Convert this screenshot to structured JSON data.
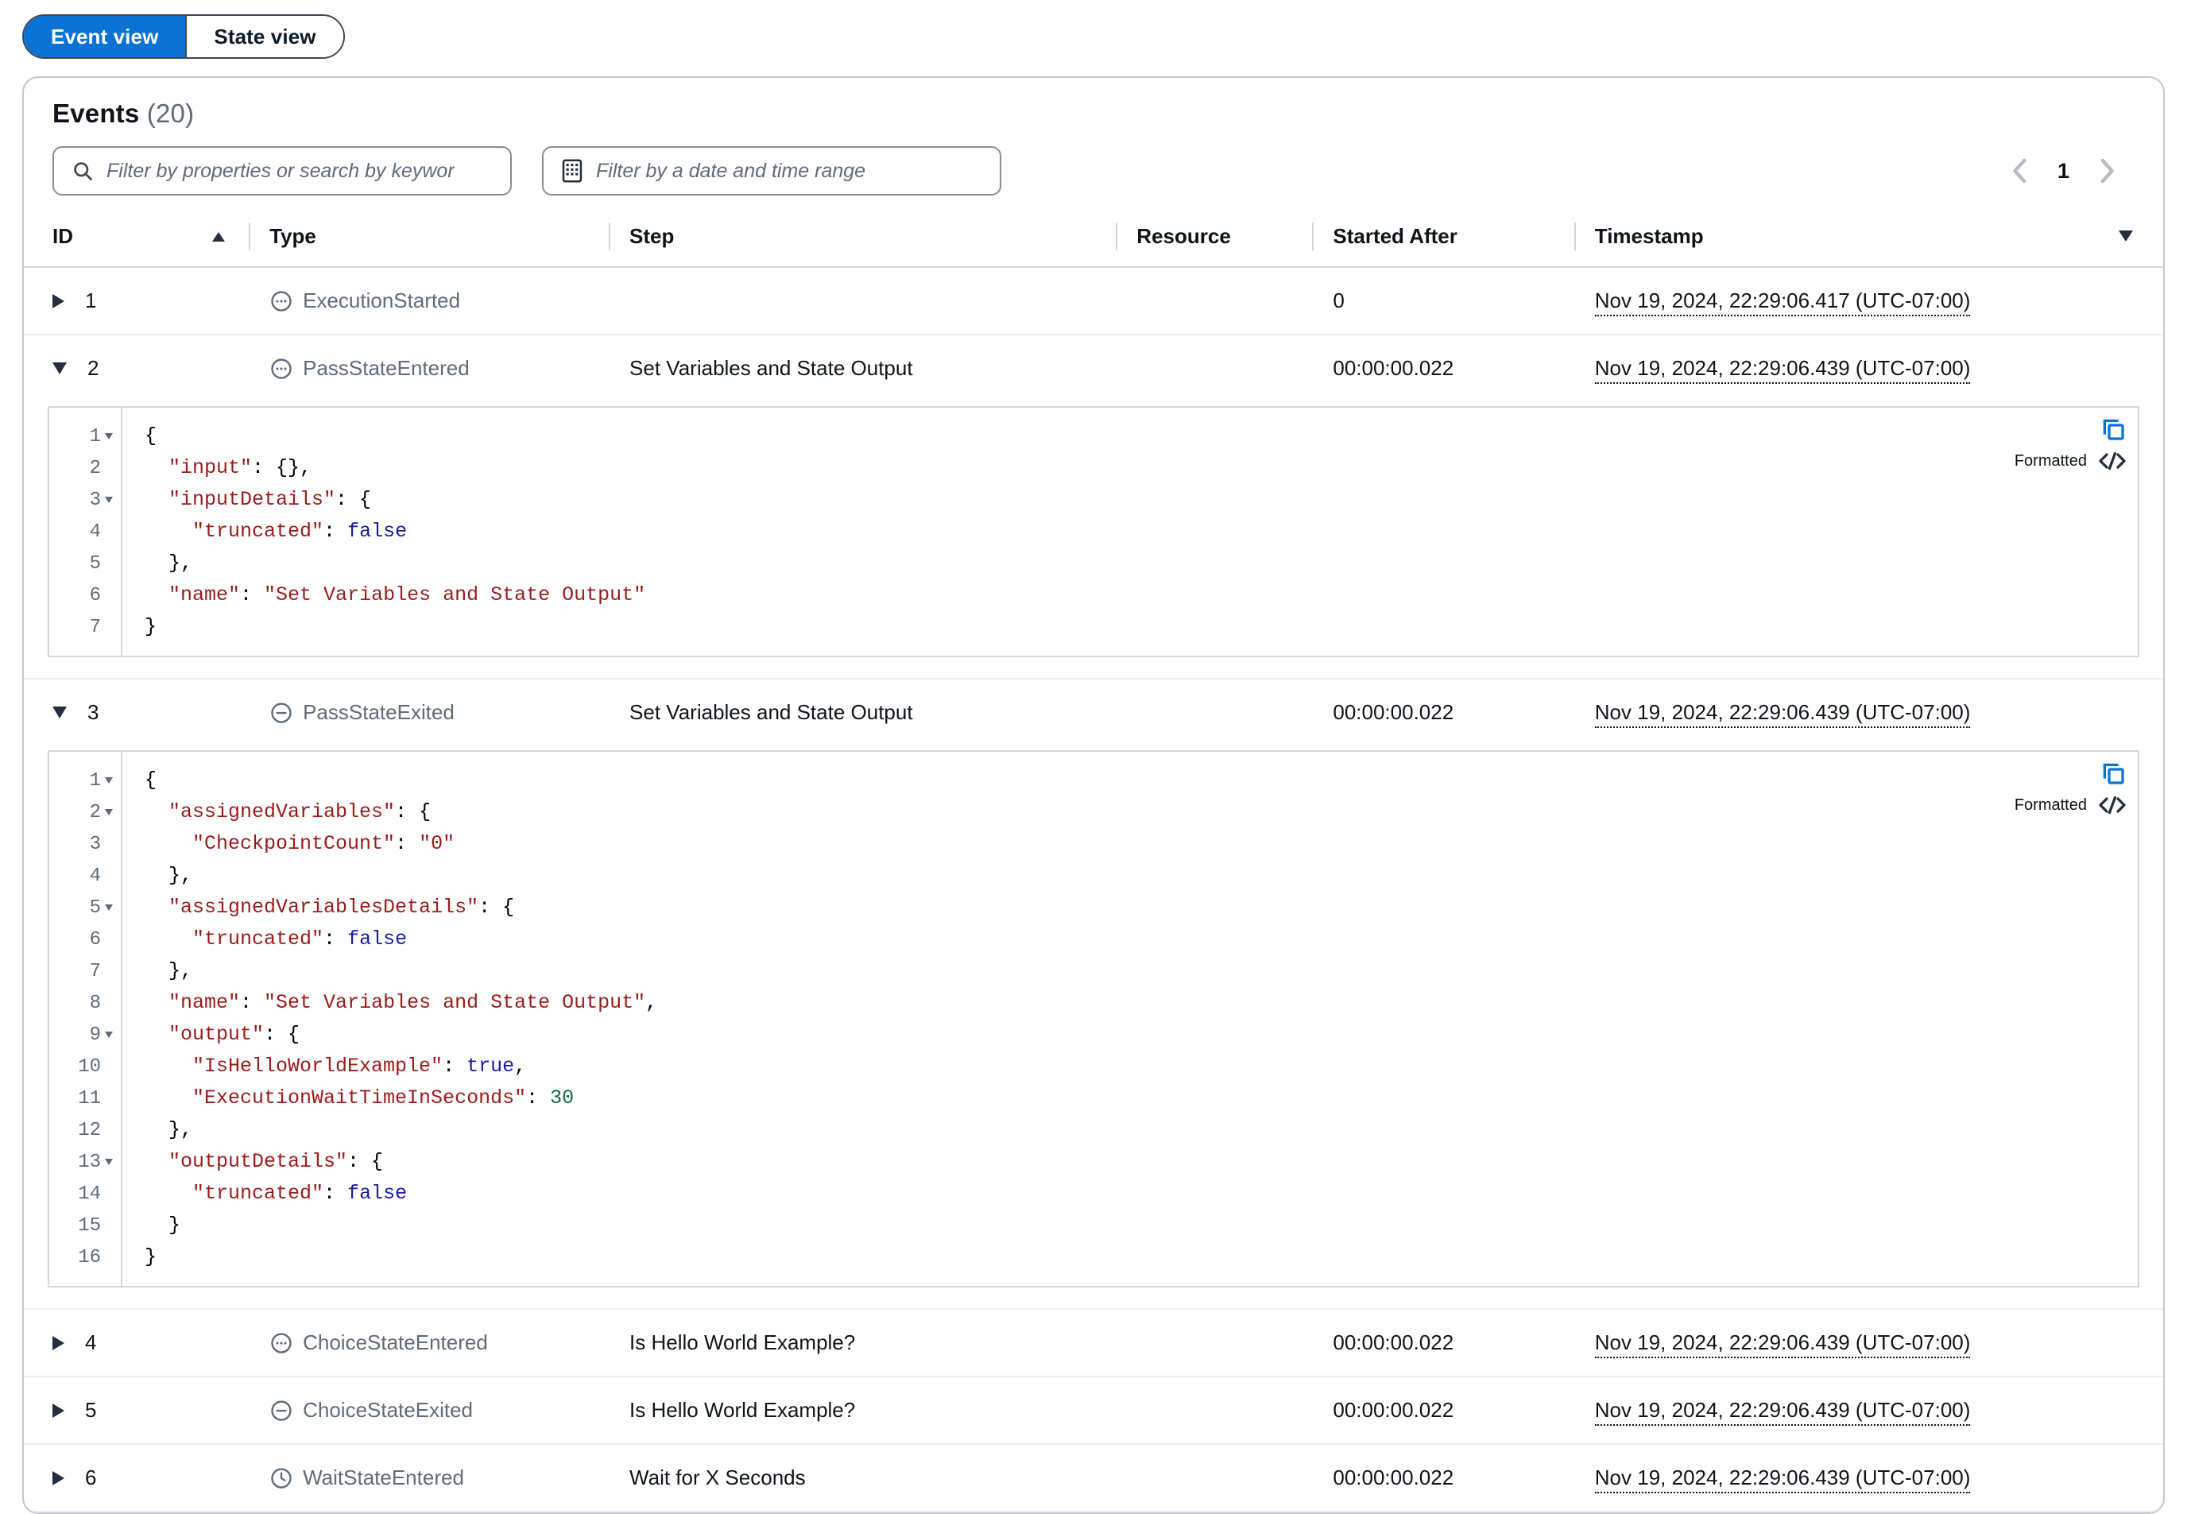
{
  "view_toggle": {
    "options": [
      {
        "label": "Event view",
        "selected": true
      },
      {
        "label": "State view",
        "selected": false
      }
    ],
    "accent_color": "#0972d3"
  },
  "panel": {
    "title": "Events",
    "count": "(20)",
    "search": {
      "placeholder": "Filter by properties or search by keywor",
      "icon": "search-icon",
      "value": ""
    },
    "date_filter": {
      "placeholder": "Filter by a date and time range",
      "icon": "calendar-icon",
      "value": ""
    },
    "pagination": {
      "prev_icon": "chevron-left-icon",
      "next_icon": "chevron-right-icon",
      "current_page": "1"
    }
  },
  "table": {
    "columns": [
      {
        "key": "id",
        "label": "ID",
        "sort_icon": "sort-ascending-icon"
      },
      {
        "key": "type",
        "label": "Type"
      },
      {
        "key": "step",
        "label": "Step"
      },
      {
        "key": "resource",
        "label": "Resource"
      },
      {
        "key": "started_after",
        "label": "Started After"
      },
      {
        "key": "timestamp",
        "label": "Timestamp",
        "settings_icon": "filter-icon"
      }
    ],
    "rows": [
      {
        "id": "1",
        "expanded": false,
        "caret": "caret-right-icon",
        "type": "ExecutionStarted",
        "type_icon": "circle-ellipsis-icon",
        "step": "",
        "resource": "",
        "started_after": "0",
        "timestamp": "Nov 19, 2024, 22:29:06.417 (UTC-07:00)"
      },
      {
        "id": "2",
        "expanded": true,
        "caret": "caret-down-icon",
        "type": "PassStateEntered",
        "type_icon": "circle-ellipsis-icon",
        "step": "Set Variables and State Output",
        "resource": "",
        "started_after": "00:00:00.022",
        "timestamp": "Nov 19, 2024, 22:29:06.439 (UTC-07:00)",
        "detail": {
          "formatted_label": "Formatted",
          "copy_icon": "copy-icon",
          "code_icon": "code-brackets-icon",
          "lines": [
            {
              "n": "1",
              "fold": true,
              "tokens": [
                {
                  "t": "{",
                  "c": "p"
                }
              ]
            },
            {
              "n": "2",
              "fold": false,
              "tokens": [
                {
                  "t": "  \"input\"",
                  "c": "k"
                },
                {
                  "t": ": ",
                  "c": "p"
                },
                {
                  "t": "{},",
                  "c": "p"
                }
              ]
            },
            {
              "n": "3",
              "fold": true,
              "tokens": [
                {
                  "t": "  \"inputDetails\"",
                  "c": "k"
                },
                {
                  "t": ": {",
                  "c": "p"
                }
              ]
            },
            {
              "n": "4",
              "fold": false,
              "tokens": [
                {
                  "t": "    \"truncated\"",
                  "c": "k"
                },
                {
                  "t": ": ",
                  "c": "p"
                },
                {
                  "t": "false",
                  "c": "b"
                }
              ]
            },
            {
              "n": "5",
              "fold": false,
              "tokens": [
                {
                  "t": "  },",
                  "c": "p"
                }
              ]
            },
            {
              "n": "6",
              "fold": false,
              "tokens": [
                {
                  "t": "  \"name\"",
                  "c": "k"
                },
                {
                  "t": ": ",
                  "c": "p"
                },
                {
                  "t": "\"Set Variables and State Output\"",
                  "c": "s"
                }
              ]
            },
            {
              "n": "7",
              "fold": false,
              "tokens": [
                {
                  "t": "}",
                  "c": "p"
                }
              ]
            }
          ]
        }
      },
      {
        "id": "3",
        "expanded": true,
        "caret": "caret-down-icon",
        "type": "PassStateExited",
        "type_icon": "circle-minus-icon",
        "step": "Set Variables and State Output",
        "resource": "",
        "started_after": "00:00:00.022",
        "timestamp": "Nov 19, 2024, 22:29:06.439 (UTC-07:00)",
        "detail": {
          "formatted_label": "Formatted",
          "copy_icon": "copy-icon",
          "code_icon": "code-brackets-icon",
          "lines": [
            {
              "n": "1",
              "fold": true,
              "tokens": [
                {
                  "t": "{",
                  "c": "p"
                }
              ]
            },
            {
              "n": "2",
              "fold": true,
              "tokens": [
                {
                  "t": "  \"assignedVariables\"",
                  "c": "k"
                },
                {
                  "t": ": {",
                  "c": "p"
                }
              ]
            },
            {
              "n": "3",
              "fold": false,
              "tokens": [
                {
                  "t": "    \"CheckpointCount\"",
                  "c": "k"
                },
                {
                  "t": ": ",
                  "c": "p"
                },
                {
                  "t": "\"0\"",
                  "c": "s"
                }
              ]
            },
            {
              "n": "4",
              "fold": false,
              "tokens": [
                {
                  "t": "  },",
                  "c": "p"
                }
              ]
            },
            {
              "n": "5",
              "fold": true,
              "tokens": [
                {
                  "t": "  \"assignedVariablesDetails\"",
                  "c": "k"
                },
                {
                  "t": ": {",
                  "c": "p"
                }
              ]
            },
            {
              "n": "6",
              "fold": false,
              "tokens": [
                {
                  "t": "    \"truncated\"",
                  "c": "k"
                },
                {
                  "t": ": ",
                  "c": "p"
                },
                {
                  "t": "false",
                  "c": "b"
                }
              ]
            },
            {
              "n": "7",
              "fold": false,
              "tokens": [
                {
                  "t": "  },",
                  "c": "p"
                }
              ]
            },
            {
              "n": "8",
              "fold": false,
              "tokens": [
                {
                  "t": "  \"name\"",
                  "c": "k"
                },
                {
                  "t": ": ",
                  "c": "p"
                },
                {
                  "t": "\"Set Variables and State Output\"",
                  "c": "s"
                },
                {
                  "t": ",",
                  "c": "p"
                }
              ]
            },
            {
              "n": "9",
              "fold": true,
              "tokens": [
                {
                  "t": "  \"output\"",
                  "c": "k"
                },
                {
                  "t": ": {",
                  "c": "p"
                }
              ]
            },
            {
              "n": "10",
              "fold": false,
              "tokens": [
                {
                  "t": "    \"IsHelloWorldExample\"",
                  "c": "k"
                },
                {
                  "t": ": ",
                  "c": "p"
                },
                {
                  "t": "true",
                  "c": "b"
                },
                {
                  "t": ",",
                  "c": "p"
                }
              ]
            },
            {
              "n": "11",
              "fold": false,
              "tokens": [
                {
                  "t": "    \"ExecutionWaitTimeInSeconds\"",
                  "c": "k"
                },
                {
                  "t": ": ",
                  "c": "p"
                },
                {
                  "t": "30",
                  "c": "n"
                }
              ]
            },
            {
              "n": "12",
              "fold": false,
              "tokens": [
                {
                  "t": "  },",
                  "c": "p"
                }
              ]
            },
            {
              "n": "13",
              "fold": true,
              "tokens": [
                {
                  "t": "  \"outputDetails\"",
                  "c": "k"
                },
                {
                  "t": ": {",
                  "c": "p"
                }
              ]
            },
            {
              "n": "14",
              "fold": false,
              "tokens": [
                {
                  "t": "    \"truncated\"",
                  "c": "k"
                },
                {
                  "t": ": ",
                  "c": "p"
                },
                {
                  "t": "false",
                  "c": "b"
                }
              ]
            },
            {
              "n": "15",
              "fold": false,
              "tokens": [
                {
                  "t": "  }",
                  "c": "p"
                }
              ]
            },
            {
              "n": "16",
              "fold": false,
              "tokens": [
                {
                  "t": "}",
                  "c": "p"
                }
              ]
            }
          ]
        }
      },
      {
        "id": "4",
        "expanded": false,
        "caret": "caret-right-icon",
        "type": "ChoiceStateEntered",
        "type_icon": "circle-ellipsis-icon",
        "step": "Is Hello World Example?",
        "resource": "",
        "started_after": "00:00:00.022",
        "timestamp": "Nov 19, 2024, 22:29:06.439 (UTC-07:00)"
      },
      {
        "id": "5",
        "expanded": false,
        "caret": "caret-right-icon",
        "type": "ChoiceStateExited",
        "type_icon": "circle-minus-icon",
        "step": "Is Hello World Example?",
        "resource": "",
        "started_after": "00:00:00.022",
        "timestamp": "Nov 19, 2024, 22:29:06.439 (UTC-07:00)"
      },
      {
        "id": "6",
        "expanded": false,
        "caret": "caret-right-icon",
        "type": "WaitStateEntered",
        "type_icon": "circle-clock-icon",
        "step": "Wait for X Seconds",
        "resource": "",
        "started_after": "00:00:00.022",
        "timestamp": "Nov 19, 2024, 22:29:06.439 (UTC-07:00)"
      }
    ]
  }
}
